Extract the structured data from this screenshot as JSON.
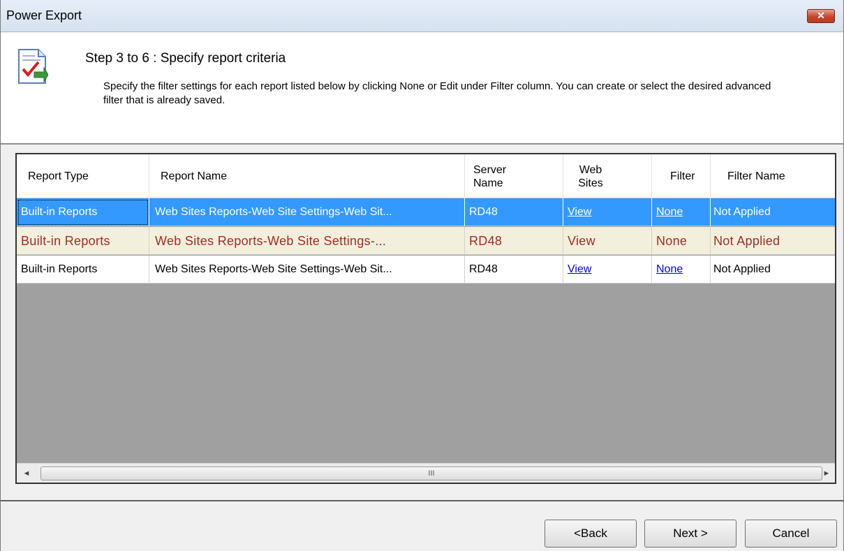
{
  "window": {
    "title": "Power Export",
    "close_label": "✕"
  },
  "header": {
    "step_title": "Step 3 to 6 : Specify report criteria",
    "description": "Specify the filter settings for each report listed below by clicking None or Edit under Filter column. You can create or select the desired advanced filter that is already saved."
  },
  "grid": {
    "columns": [
      "Report Type",
      "Report Name",
      "Server Name",
      "Web Sites",
      "Filter",
      "Filter Name"
    ],
    "rows": [
      {
        "report_type": "Built-in Reports",
        "report_name": "Web Sites Reports-Web Site Settings-Web Sit...",
        "server_name": "RD48",
        "web_sites": "View",
        "filter": "None",
        "filter_name": "Not Applied",
        "state": "selected"
      },
      {
        "report_type": "Built-in Reports",
        "report_name": "Web Sites Reports-Web Site Settings-...",
        "server_name": "RD48",
        "web_sites": "View",
        "filter": "None",
        "filter_name": "Not Applied",
        "state": "hover"
      },
      {
        "report_type": "Built-in Reports",
        "report_name": "Web Sites Reports-Web Site Settings-Web Sit...",
        "server_name": "RD48",
        "web_sites": "View",
        "filter": "None",
        "filter_name": "Not Applied",
        "state": "normal"
      }
    ],
    "scrollbar": {
      "left_arrow": "◄",
      "right_arrow": "►",
      "grip": "III"
    }
  },
  "buttons": {
    "back": "<Back",
    "next": "Next >",
    "cancel": "Cancel"
  },
  "colors": {
    "selection": "#3399ff",
    "hover_row": "#f2f0dc",
    "hover_text": "#a52a2a"
  }
}
